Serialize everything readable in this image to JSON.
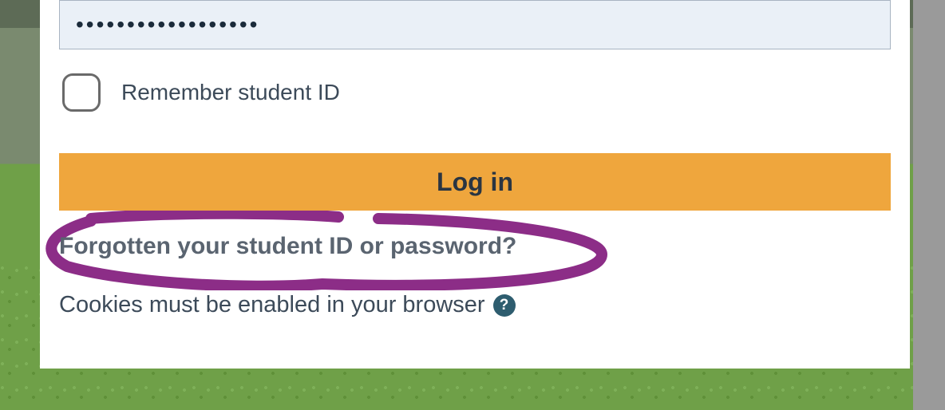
{
  "password": {
    "value": "••••••••••••••••••",
    "type": "password"
  },
  "remember": {
    "label": "Remember student ID"
  },
  "login": {
    "label": "Log in"
  },
  "forgot": {
    "label": "Forgotten your student ID or password?"
  },
  "cookies": {
    "text": "Cookies must be enabled in your browser",
    "help": "?"
  },
  "annotation": {
    "color": "#8c2d87"
  }
}
